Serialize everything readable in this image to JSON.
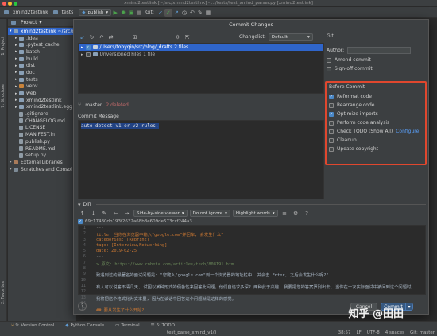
{
  "window": {
    "title": "xmind2testlink [~/src/xmind2testlink] - .../tests/test_xmind_parser.py [xmind2testlink]",
    "traffic": [
      "#ff5f57",
      "#febc2e",
      "#28c840"
    ]
  },
  "toolbar": {
    "crumb1": "xmind2testlink",
    "crumb2": "tests",
    "run_config": "publish",
    "vcs_label": "Git:"
  },
  "left_strip": {
    "tab_project": "1: Project",
    "tab_structure": "7: Structure",
    "tab_favorites": "2: Favorites"
  },
  "project": {
    "header": "Project",
    "items": [
      {
        "label": "xmind2testlink ~/src/x",
        "type": "root"
      },
      {
        "label": ".idea",
        "type": "folder"
      },
      {
        "label": ".pytest_cache",
        "type": "folder"
      },
      {
        "label": "batch",
        "type": "folder"
      },
      {
        "label": "build",
        "type": "folder"
      },
      {
        "label": "dist",
        "type": "folder"
      },
      {
        "label": "doc",
        "type": "folder"
      },
      {
        "label": "tests",
        "type": "folder"
      },
      {
        "label": "venv",
        "type": "folder-orange"
      },
      {
        "label": "web",
        "type": "folder"
      },
      {
        "label": "xmind2testlink",
        "type": "folder"
      },
      {
        "label": "xmind2testlink.egg",
        "type": "folder"
      },
      {
        "label": ".gitignore",
        "type": "file"
      },
      {
        "label": "CHANGELOG.md",
        "type": "file"
      },
      {
        "label": "LICENSE",
        "type": "file"
      },
      {
        "label": "MANIFEST.in",
        "type": "file"
      },
      {
        "label": "publish.py",
        "type": "file"
      },
      {
        "label": "README.md",
        "type": "file"
      },
      {
        "label": "setup.py",
        "type": "file"
      },
      {
        "label": "External Libraries",
        "type": "lib"
      },
      {
        "label": "Scratches and Consol",
        "type": "scratch"
      }
    ]
  },
  "dialog": {
    "title": "Commit Changes",
    "changelist_label": "Changelist:",
    "changelist_value": "Default",
    "changes": [
      {
        "label": "/Users/tobyqin/src/blog/_drafts  2 files",
        "selected": true,
        "checked": true
      },
      {
        "label": "Unversioned Files  1 file",
        "selected": false,
        "checked": false
      }
    ],
    "branch": "master",
    "deleted": "2 deleted",
    "commit_message_label": "Commit Message",
    "commit_message": "auto detect v1 or v2 rules.",
    "git_label": "Git",
    "author_label": "Author:",
    "amend": "Amend commit",
    "signoff": "Sign-off commit",
    "before_commit_label": "Before Commit",
    "before_commit": [
      {
        "label": "Reformat code",
        "checked": true
      },
      {
        "label": "Rearrange code",
        "checked": false
      },
      {
        "label": "Optimize imports",
        "checked": true
      },
      {
        "label": "Perform code analysis",
        "checked": false
      },
      {
        "label": "Check TODO (Show All)",
        "checked": false,
        "link": "Configure"
      },
      {
        "label": "Cleanup",
        "checked": false
      },
      {
        "label": "Update copyright",
        "checked": false
      }
    ],
    "diff_label": "Diff",
    "diff_viewer": "Side-by-side viewer",
    "diff_ignore": "Do not ignore",
    "diff_highlight": "Highlight words",
    "diff_hash": "69c17480db193f2632a68b8e609de573ccf244a3",
    "code_lines": [
      {
        "n": "1",
        "t": "---",
        "c": "#8a8a8a"
      },
      {
        "n": "2",
        "t": "title: 当你在浏览器中输入\"google.com\"并回车, 会发生什么?",
        "c": "#cc7832"
      },
      {
        "n": "3",
        "t": "categories: [Reprint]",
        "c": "#cc7832"
      },
      {
        "n": "4",
        "t": "tags: [Interview,Networking]",
        "c": "#cc7832"
      },
      {
        "n": "5",
        "t": "date: 2019-02-25",
        "c": "#cc7832"
      },
      {
        "n": "6",
        "t": "---",
        "c": "#8a8a8a"
      },
      {
        "n": "7",
        "t": "> 原文: https://www.cnbeta.com/articles/tech/808191.htm",
        "c": "#6a8759"
      },
      {
        "n": "8",
        "t": "",
        "c": "#a9b7c6"
      },
      {
        "n": "9",
        "t": "致遇到过的最著名的面试问题是: \"您键入\"google.com\"到一个浏览器的地址栏中, 并会击 Enter, 之后会发生什么呢?\"",
        "c": "#a9b7c6"
      },
      {
        "n": "10",
        "t": "",
        "c": "#a9b7c6"
      },
      {
        "n": "11",
        "t": "有人可以说答不清几天, 试图以某种形式的便备性来回答此问题。他们自追求多深? 两种此于兴趣, 我要把您的答案罗列出去, 当你在一次实际面试中被问到这个问题时。",
        "c": "#a9b7c6"
      },
      {
        "n": "12",
        "t": "",
        "c": "#a9b7c6"
      },
      {
        "n": "13",
        "t": "我将把这个格式化为文本里, 因为在谈话中回答这个问题就是这样的感觉。",
        "c": "#a9b7c6"
      },
      {
        "n": "14",
        "t": "",
        "c": "#a9b7c6"
      },
      {
        "n": "15",
        "t": "## 要从发生了什么开始?",
        "c": "#cc7832"
      }
    ],
    "help": "?",
    "cancel": "Cancel",
    "commit": "Commit"
  },
  "bottom_tabs": [
    "9: Version Control",
    "Python Console",
    "Terminal",
    "6: TODO"
  ],
  "status": {
    "left": "test_parse_xmind_v1()",
    "pos": "38:57",
    "lf": "LF",
    "enc": "UTF-8",
    "indent": "4 spaces",
    "git": "Git: master"
  },
  "watermark": "知乎 @田田"
}
